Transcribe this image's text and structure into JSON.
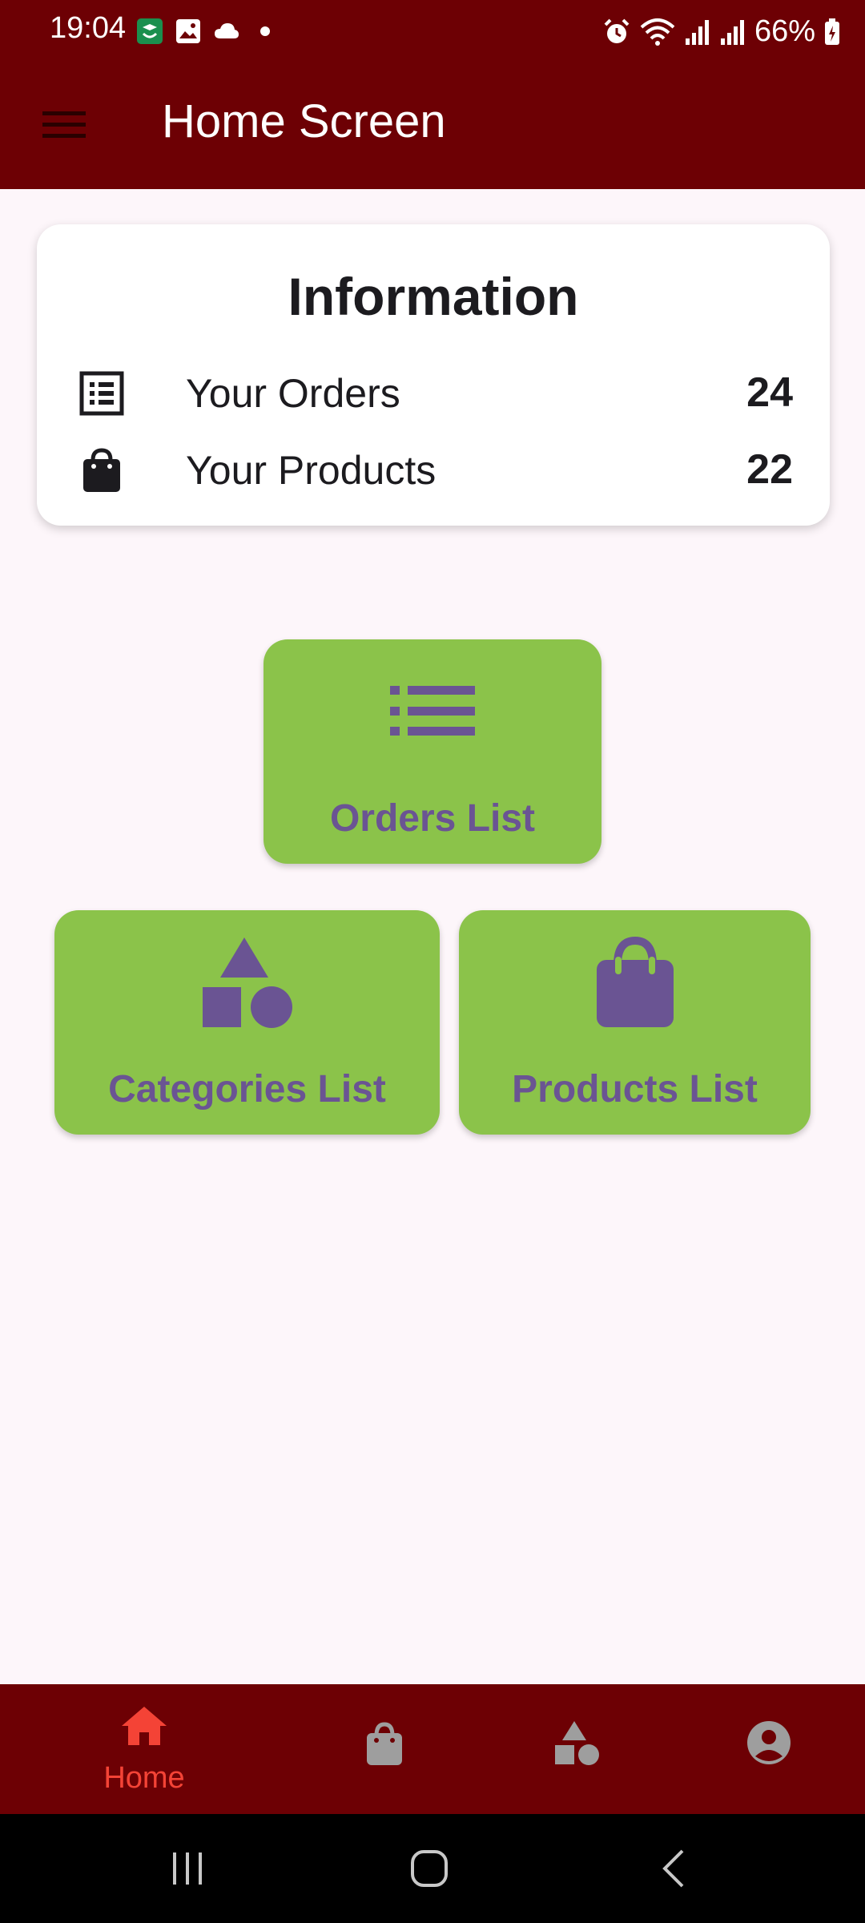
{
  "status_bar": {
    "time": "19:04",
    "battery": "66%"
  },
  "app_bar": {
    "title": "Home Screen",
    "menu_icon": "hamburger-menu-icon"
  },
  "info_card": {
    "title": "Information",
    "rows": [
      {
        "icon": "list-alt-icon",
        "label": "Your Orders",
        "value": "24"
      },
      {
        "icon": "shopping-bag-icon",
        "label": "Your Products",
        "value": "22"
      }
    ]
  },
  "tiles": {
    "orders": {
      "label": "Orders List",
      "icon": "list-icon"
    },
    "categories": {
      "label": "Categories List",
      "icon": "category-shapes-icon"
    },
    "products": {
      "label": "Products List",
      "icon": "shopping-bag-icon"
    }
  },
  "bottom_nav": {
    "items": [
      {
        "label": "Home",
        "icon": "home-icon",
        "active": true
      },
      {
        "label": "",
        "icon": "shopping-bag-icon",
        "active": false
      },
      {
        "label": "",
        "icon": "category-shapes-icon",
        "active": false
      },
      {
        "label": "",
        "icon": "account-circle-icon",
        "active": false
      }
    ]
  },
  "colors": {
    "app_bar": "#6d0004",
    "background": "#fdf6fa",
    "tile": "#8bc34a",
    "tile_content": "#6a5493",
    "nav_active": "#f44336",
    "nav_inactive": "#9e9e9e"
  }
}
